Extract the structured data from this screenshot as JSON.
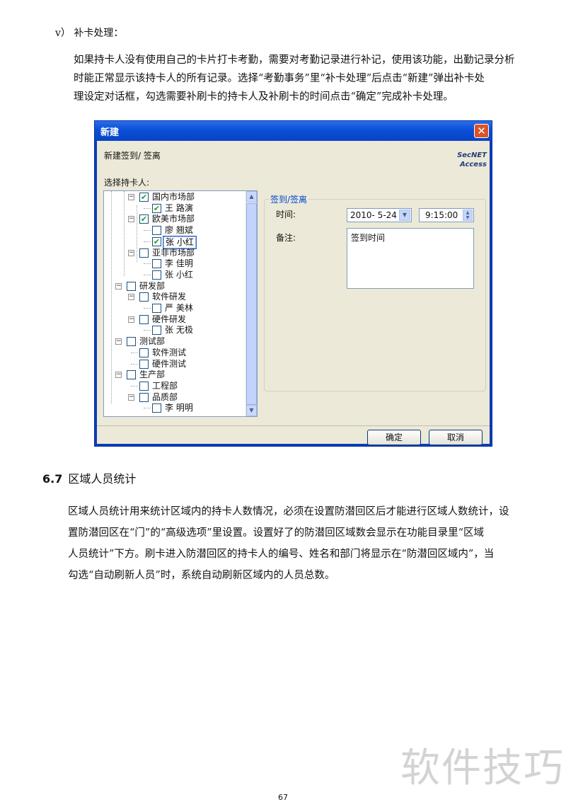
{
  "doc": {
    "step_heading": "v）  补卡处理：",
    "para1_lines": [
      "如果持卡人没有使用自己的卡片打卡考勤，需要对考勤记录进行补记，使用该功能，出勤记录分析",
      "时能正常显示该持卡人的所有记录。选择“考勤事务”里“补卡处理”后点击“新建”弹出补卡处",
      "理设定对话框，勾选需要补刷卡的持卡人及补刷卡的时间点击“确定”完成补卡处理。"
    ],
    "section_number": "6.7",
    "section_title": "区域人员统计",
    "para2_lines": [
      "区域人员统计用来统计区域内的持卡人数情况，必须在设置防潜回区后才能进行区域人数统计，设",
      "置防潜回区在“门”的“高级选项”里设置。设置好了的防潜回区域数会显示在功能目录里“区域",
      "人员统计”下方。刷卡进入防潜回区的持卡人的编号、姓名和部门将显示在“防潜回区域内”，当",
      "勾选“自动刷新人员”时，系统自动刷新区域内的人员总数。"
    ],
    "page_number": "67",
    "watermark": "软件技巧"
  },
  "dialog": {
    "title": "新建",
    "close_glyph": "✕",
    "subtitle": "新建签到/ 签离",
    "logo_line1": "SecNET",
    "logo_line2": "Access",
    "select_label": "选择持卡人:",
    "tree": [
      {
        "label": "国内市场部",
        "checked": true,
        "expander": "−"
      },
      {
        "label": "王 路演",
        "checked": true
      },
      {
        "label": "欧美市场部",
        "checked": true,
        "expander": "−"
      },
      {
        "label": "廖 翘斌",
        "checked": false
      },
      {
        "label": "张 小红",
        "checked": true,
        "selected": true
      },
      {
        "label": "亚非市场部",
        "checked": false,
        "expander": "−"
      },
      {
        "label": "李 佳明",
        "checked": false
      },
      {
        "label": "张 小红",
        "checked": false
      },
      {
        "label": "研发部",
        "checked": false,
        "expander": "−"
      },
      {
        "label": "软件研发",
        "checked": false,
        "expander": "−"
      },
      {
        "label": "严 美林",
        "checked": false
      },
      {
        "label": "硬件研发",
        "checked": false,
        "expander": "−"
      },
      {
        "label": "张 无极",
        "checked": false
      },
      {
        "label": "测试部",
        "checked": false,
        "expander": "−"
      },
      {
        "label": "软件测试",
        "checked": false
      },
      {
        "label": "硬件测试",
        "checked": false
      },
      {
        "label": "生产部",
        "checked": false,
        "expander": "−"
      },
      {
        "label": "工程部",
        "checked": false
      },
      {
        "label": "品质部",
        "checked": false,
        "expander": "−"
      },
      {
        "label": "李 明明",
        "checked": false
      }
    ],
    "group_legend": "签到/签离",
    "time_label": "时间:",
    "date_value": "2010- 5-24",
    "time_value": "9:15:00",
    "note_label": "备注:",
    "note_value": "签到时间",
    "ok_label": "确定",
    "cancel_label": "取消"
  }
}
